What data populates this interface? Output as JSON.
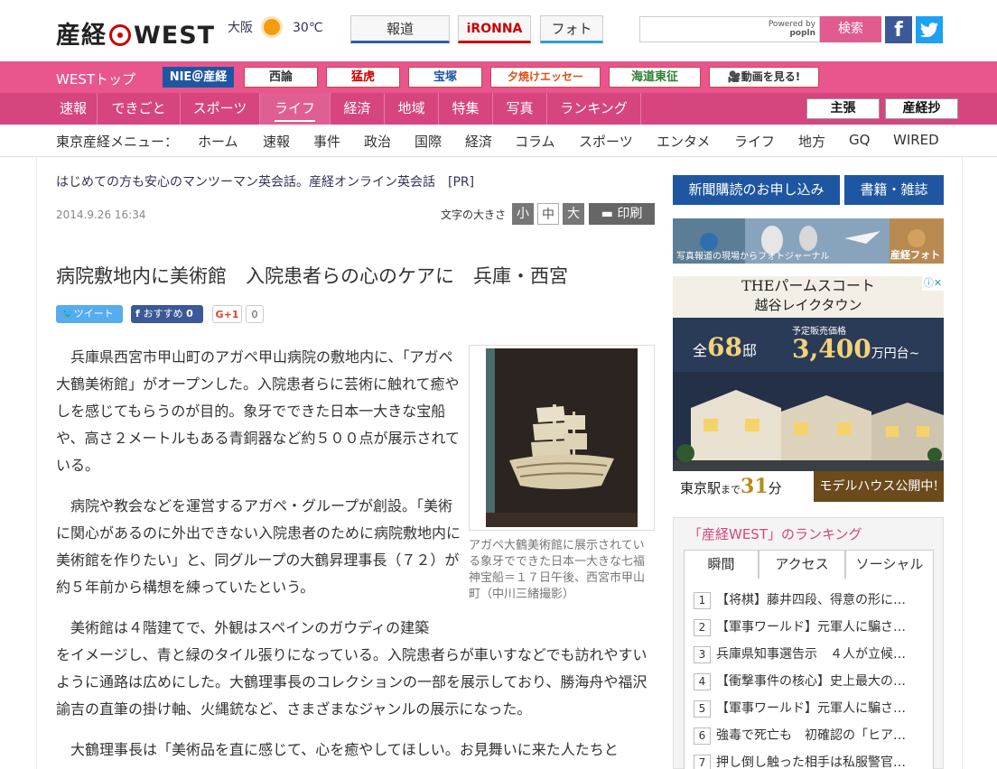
{
  "header": {
    "logo": "産経",
    "logo_suffix": "WEST",
    "weather_city": "大阪",
    "weather_temp": "30℃",
    "buttons": [
      "報道",
      "iRONNA",
      "フォト"
    ],
    "search_powered": "Powered by",
    "search_brand": "popln",
    "search_label": "検索",
    "facebook": "f",
    "twitter": "t"
  },
  "nav1": {
    "home": "WESTトップ",
    "items": [
      "NIE＠産経",
      "西論",
      "猛虎",
      "宝塚",
      "夕焼けエッセー",
      "海道東征",
      "動画を見る!"
    ]
  },
  "nav2": {
    "items": [
      "速報",
      "できごと",
      "スポーツ",
      "ライフ",
      "経済",
      "地域",
      "特集",
      "写真",
      "ランキング"
    ],
    "active": "ライフ",
    "right": [
      "主張",
      "産経抄"
    ]
  },
  "nav3": {
    "label": "東京産経メニュー：",
    "items": [
      "ホーム",
      "速報",
      "事件",
      "政治",
      "国際",
      "経済",
      "コラム",
      "スポーツ",
      "エンタメ",
      "ライフ",
      "地方",
      "GQ",
      "WIRED"
    ]
  },
  "article": {
    "pr": "はじめての方も安心のマンツーマン英会話。産経オンライン英会話　[PR]",
    "date": "2014.9.26 16:34",
    "font_size_label": "文字の大きさ",
    "font_sizes": [
      "小",
      "中",
      "大"
    ],
    "print": "印刷",
    "headline": "病院敷地内に美術館　入院患者らの心のケアに　兵庫・西宮",
    "social": {
      "tweet": "ツイート",
      "recommend": "おすすめ",
      "recommend_count": "0",
      "gplus": "G+1",
      "gplus_count": "0"
    },
    "paragraphs": [
      "兵庫県西宮市甲山町のアガペ甲山病院の敷地内に、「アガペ大鶴美術館」がオープンした。入院患者らに芸術に触れて癒やしを感じてもらうのが目的。象牙でできた日本一大きな宝船や、高さ２メートルもある青銅器など約５００点が展示されている。",
      "病院や教会などを運営するアガペ・グループが創設。「美術に関心があるのに外出できない入院患者のために病院敷地内に美術館を作りたい」と、同グループの大鶴昇理事長（７２）が約５年前から構想を練っていたという。",
      "美術館は４階建てで、外観はスペインのガウディの建築",
      "をイメージし、青と緑のタイル張りになっている。入院患者らが車いすなどでも訪れやすいように通路は広めにした。大鶴理事長のコレクションの一部を展示しており、勝海舟や福沢諭吉の直筆の掛け軸、火縄銃など、さまざまなジャンルの展示になった。",
      "大鶴理事長は「美術品を直に感じて、心を癒やしてほしい。お見舞いに来た人たちと"
    ],
    "caption": "アガペ大鶴美術館に展示されている象牙でできた日本一大きな七福神宝船＝１７日午後、西宮市甲山町（中川三緒撮影）"
  },
  "sidebar": {
    "btn_subscribe": "新聞購読のお申し込み",
    "btn_books": "書籍・雑誌",
    "photo_banner": "写真報道の現場からフォトジャーナル",
    "photo_brand": "産経フォト",
    "ad": {
      "title1": "THEパームスコート",
      "title2": "越谷レイクタウン",
      "pre": "予定販売価格",
      "count_pre": "全",
      "count": "68",
      "count_suf": "邸",
      "price": "3,400",
      "price_suf": "万円台~",
      "station": "東京駅",
      "made": "まで",
      "minutes": "31",
      "min_suf": "分",
      "cta": "モデルハウス公開中!",
      "info": "ⓘ✕"
    },
    "ranking": {
      "title": "「産経WEST」のランキング",
      "tabs": [
        "瞬間",
        "アクセス",
        "ソーシャル"
      ],
      "items": [
        "【将棋】藤井四段、得意の形に…",
        "【軍事ワールド】元軍人に騙さ…",
        "兵庫県知事選告示　４人が立候…",
        "【衝撃事件の核心】史上最大の…",
        "【軍事ワールド】元軍人に騙さ…",
        "強毒で死亡も　初確認の「ヒア…",
        "押し倒し触った相手は私服警官…"
      ]
    }
  },
  "colors": {
    "pink": "#e8568d",
    "pink_dark": "#d6457e",
    "blue": "#1f56a1"
  }
}
